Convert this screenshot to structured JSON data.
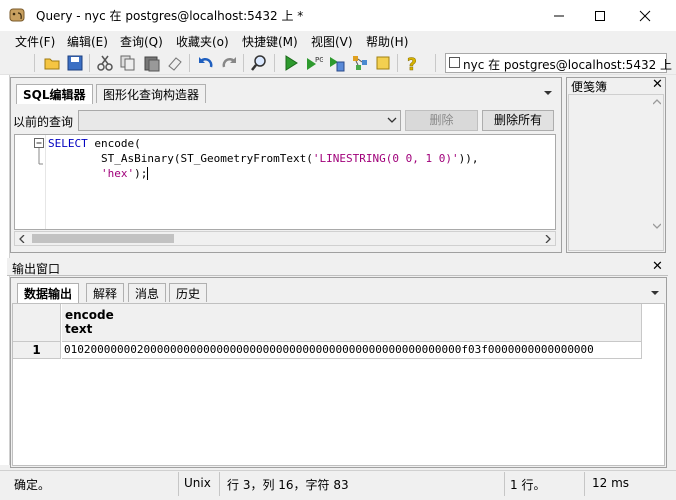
{
  "window": {
    "title": "Query - nyc 在  postgres@localhost:5432 上 *"
  },
  "menu": {
    "items": [
      "文件(F)",
      "编辑(E)",
      "查询(Q)",
      "收藏夹(o)",
      "快捷键(M)",
      "视图(V)",
      "帮助(H)"
    ]
  },
  "toolbar": {
    "connection": "nyc 在  postgres@localhost:5432 上"
  },
  "editor": {
    "tabs": [
      "SQL编辑器",
      "图形化查询构造器"
    ],
    "prev_query_label": "以前的查询",
    "delete_label": "删除",
    "delete_all_label": "删除所有",
    "code": {
      "kw1": "SELECT",
      "fn1": " encode(",
      "fn2": "ST_AsBinary(ST_GeometryFromText(",
      "str1": "'LINESTRING(0 0, 1 0)'",
      "close1": ")),",
      "str2": "'hex'",
      "close2": ");"
    }
  },
  "notes": {
    "title": "便笺簿"
  },
  "output": {
    "title": "输出窗口",
    "tabs": [
      "数据输出",
      "解释",
      "消息",
      "历史"
    ],
    "columns": [
      {
        "name": "encode",
        "type": "text"
      }
    ],
    "rows": [
      {
        "num": "1",
        "value": "010200000002000000000000000000000000000000000000000000000000f03f0000000000000000"
      }
    ]
  },
  "status": {
    "state": "确定。",
    "encoding": "Unix",
    "position": "行 3，列 16，字符 83",
    "rows": "1 行。",
    "time": "12 ms"
  },
  "colors": {
    "keyword": "#0000c0",
    "string": "#a0007a"
  }
}
